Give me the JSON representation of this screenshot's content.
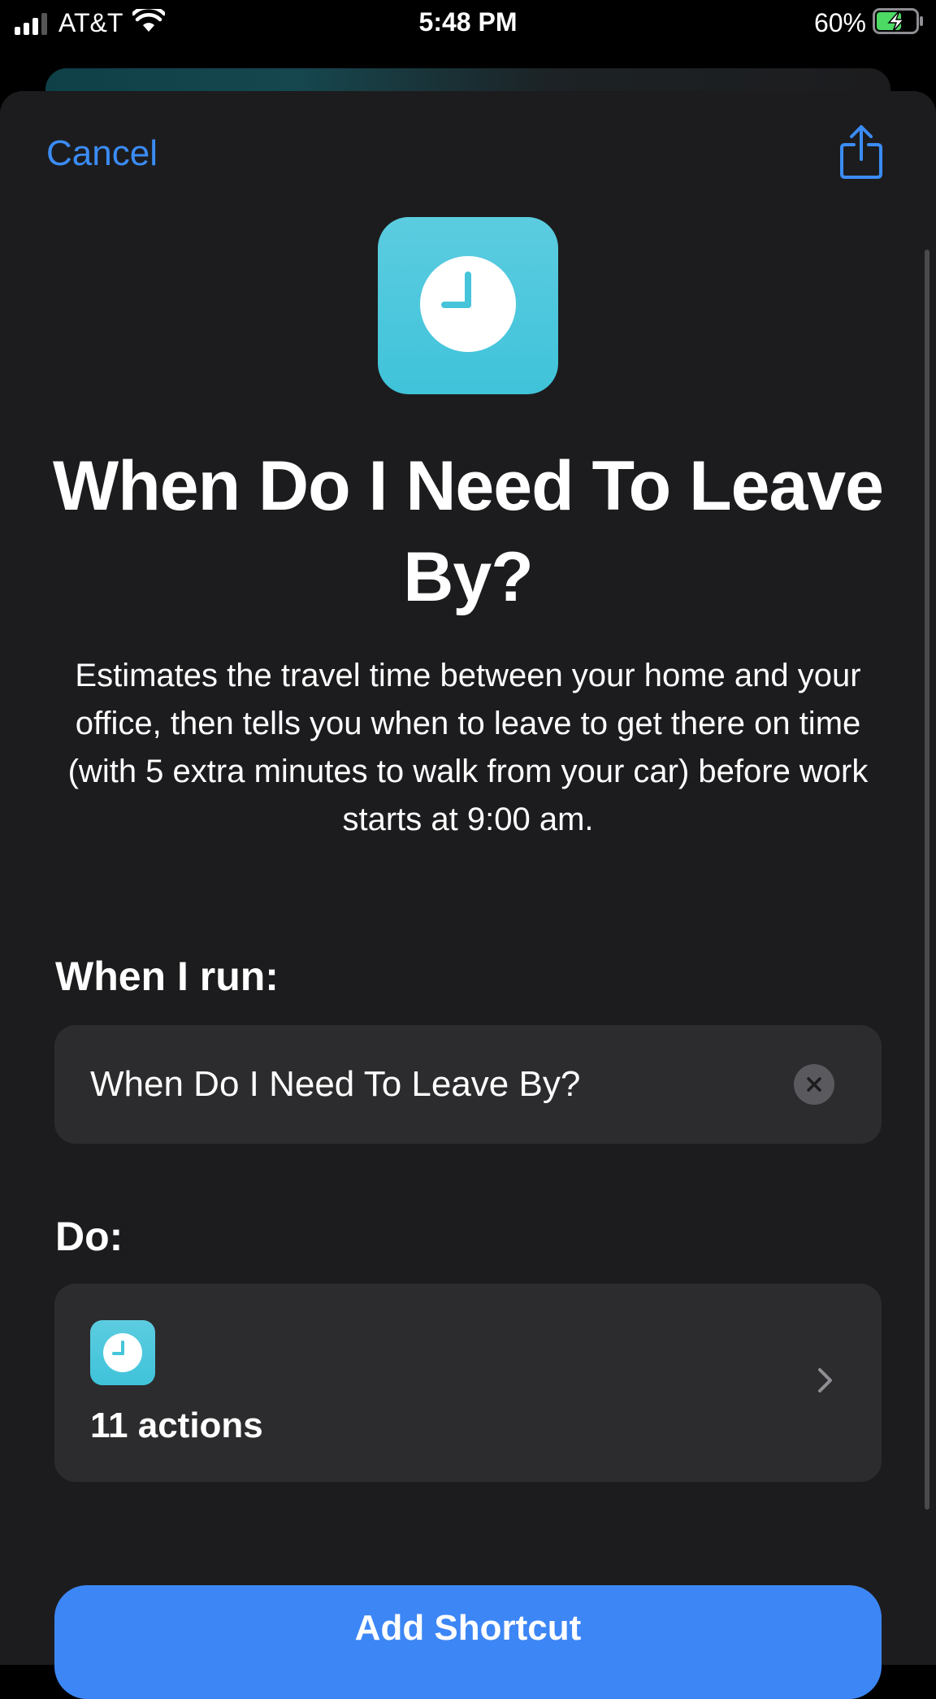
{
  "status_bar": {
    "carrier": "AT&T",
    "time": "5:48 PM",
    "battery_percent": "60%",
    "signal_bars": 3,
    "charging": true
  },
  "sheet": {
    "cancel_label": "Cancel",
    "share_icon": "share-icon"
  },
  "shortcut": {
    "icon": "clock-icon",
    "icon_color": "#45C4DA",
    "title": "When Do I Need To Leave By?",
    "description": "Estimates the travel time between your home and your office, then tells you when to leave to get there on time (with 5 extra minutes to walk from your car) before work starts at 9:00 am."
  },
  "when_i_run": {
    "label": "When I run:",
    "value": "When Do I Need To Leave By?"
  },
  "do": {
    "label": "Do:",
    "actions_text": "11 actions"
  },
  "add_button": {
    "label": "Add Shortcut",
    "color": "#3D86F6"
  },
  "colors": {
    "accent": "#3B8CF5",
    "sheet_background": "#1C1C1E",
    "card_background": "#2C2C2E"
  }
}
